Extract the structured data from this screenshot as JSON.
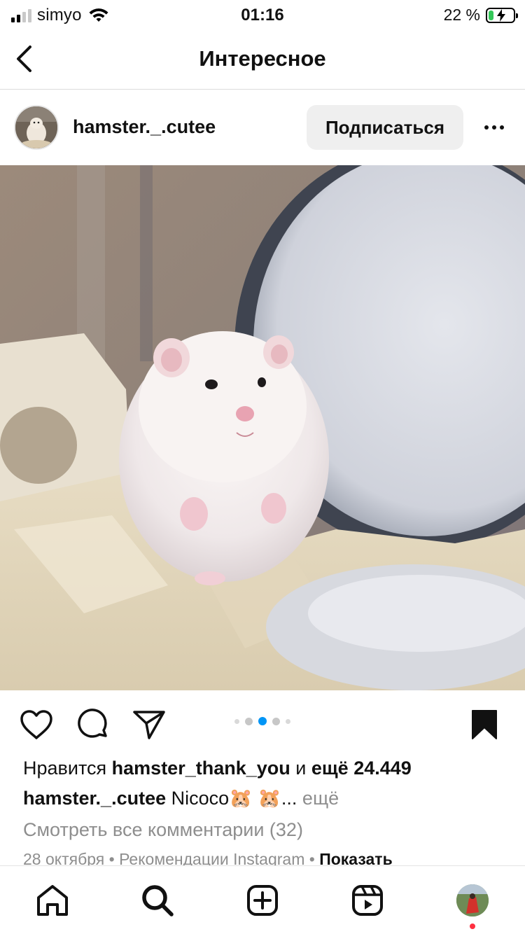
{
  "status_bar": {
    "carrier": "simyo",
    "time": "01:16",
    "battery_percent": "22 %",
    "battery_level": 0.22,
    "icons": [
      "signal-icon",
      "wifi-icon",
      "battery-charging-icon"
    ]
  },
  "nav": {
    "title": "Интересное",
    "back_icon": "chevron-left-icon"
  },
  "post": {
    "username": "hamster._.cutee",
    "follow_label": "Подписаться",
    "more_icon": "more-horizontal-icon",
    "carousel": {
      "count": 5,
      "active_index": 2
    },
    "likes": {
      "prefix": "Нравится",
      "user": "hamster_thank_you",
      "middle": "и",
      "rest": "ещё 24.449"
    },
    "caption": {
      "user": "hamster._.cutee",
      "text": "Nicoco🐹 🐹...",
      "more": "ещё"
    },
    "view_comments": "Смотреть все комментарии (32)",
    "meta": {
      "date": "28 октября",
      "separator": "•",
      "source": "Рекомендации Instagram",
      "show": "Показать"
    },
    "actions": [
      "heart-icon",
      "comment-icon",
      "share-icon",
      "bookmark-icon"
    ]
  },
  "tabbar": {
    "items": [
      "home-icon",
      "search-icon",
      "create-icon",
      "reels-icon",
      "profile-avatar"
    ],
    "active": "search"
  },
  "colors": {
    "accent_blue": "#0095f6",
    "follow_bg": "#efefef",
    "muted_text": "#8e8e8e",
    "notification_red": "#ff3040",
    "battery_green": "#34c759"
  }
}
